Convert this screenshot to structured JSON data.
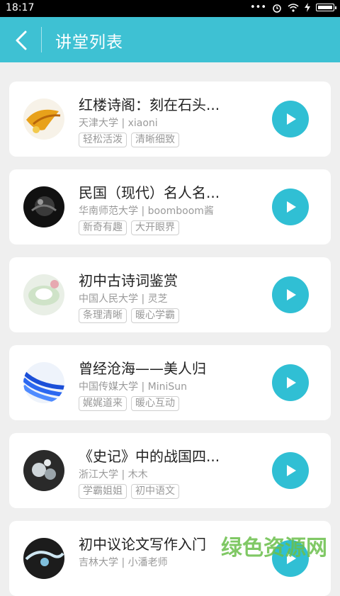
{
  "status_bar": {
    "time": "18:17",
    "signal_dots": "•••"
  },
  "header": {
    "title": "讲堂列表"
  },
  "items": [
    {
      "title": "红楼诗阁：刻在石头...",
      "subtitle": "天津大学 | xiaoni",
      "tags": [
        "轻松活泼",
        "清晰细致"
      ]
    },
    {
      "title": "民国（现代）名人名...",
      "subtitle": "华南师范大学 | boomboom酱",
      "tags": [
        "新奇有趣",
        "大开眼界"
      ]
    },
    {
      "title": "初中古诗词鉴赏",
      "subtitle": "中国人民大学 | 灵芝",
      "tags": [
        "条理清晰",
        "暖心学霸"
      ]
    },
    {
      "title": "曾经沧海——美人归",
      "subtitle": "中国传媒大学 | MiniSun",
      "tags": [
        "娓娓道来",
        "暖心互动"
      ]
    },
    {
      "title": "《史记》中的战国四...",
      "subtitle": "浙江大学 | 木木",
      "tags": [
        "学霸姐姐",
        "初中语文"
      ]
    },
    {
      "title": "初中议论文写作入门",
      "subtitle": "吉林大学 | 小潘老师",
      "tags": []
    }
  ],
  "watermark": "绿色资源网",
  "colors": {
    "accent": "#3ec1d3",
    "play": "#30bfd4"
  }
}
